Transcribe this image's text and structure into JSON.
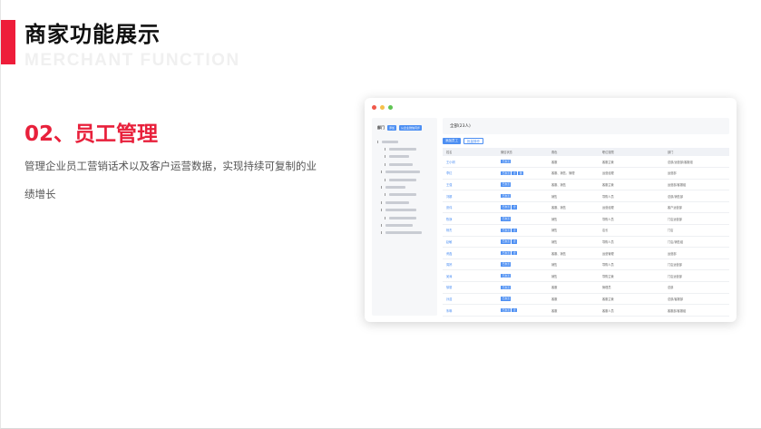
{
  "header": {
    "title": "商家功能展示",
    "subtitle": "MERCHANT FUNCTION",
    "accent_color": "#ee1d3a"
  },
  "section": {
    "title": "02、员工管理",
    "description": "管理企业员工营销话术以及客户运营数据，实现持续可复制的业绩增长"
  },
  "mockup": {
    "sidebar": {
      "label": "部门",
      "btn_add": "添加",
      "btn_sync": "从企业微信同步",
      "tree_rows": 13
    },
    "main": {
      "count_label": "全部(23人)",
      "btn_add": "添加员工",
      "btn_manage": "批量操作",
      "columns": [
        "姓名",
        "微信状态",
        "角色",
        "职位权限",
        "部门"
      ],
      "rows": [
        {
          "name": "王小明",
          "tags": [
            "已激活"
          ],
          "role": "客服",
          "position": "客服主管",
          "dept": "总部/运营部/客服组"
        },
        {
          "name": "李红",
          "tags": [
            "已激活",
            "企",
            "微"
          ],
          "role": "客服、销售、管理",
          "position": "运营经理",
          "dept": "运营部"
        },
        {
          "name": "王强",
          "tags": [
            "已激活"
          ],
          "role": "客服、销售",
          "position": "客服主管",
          "dept": "运营部/客服组"
        },
        {
          "name": "刘娜",
          "tags": [
            "已激活"
          ],
          "role": "销售",
          "position": "导购人员",
          "dept": "总部/销售部"
        },
        {
          "name": "张伟",
          "tags": [
            "已激活",
            "企"
          ],
          "role": "客服、销售",
          "position": "运营经理",
          "dept": "客户运营部"
        },
        {
          "name": "陈静",
          "tags": [
            "已激活"
          ],
          "role": "销售",
          "position": "导购人员",
          "dept": "门店运营部"
        },
        {
          "name": "杨杰",
          "tags": [
            "已激活",
            "企"
          ],
          "role": "销售",
          "position": "店长",
          "dept": "门店"
        },
        {
          "name": "赵敏",
          "tags": [
            "已激活",
            "企"
          ],
          "role": "销售",
          "position": "导购人员",
          "dept": "门店/销售组"
        },
        {
          "name": "黄磊",
          "tags": [
            "已激活",
            "企"
          ],
          "role": "客服、销售",
          "position": "运营管理",
          "dept": "运营部"
        },
        {
          "name": "周婷",
          "tags": [
            "已激活"
          ],
          "role": "销售",
          "position": "导购人员",
          "dept": "门店运营部"
        },
        {
          "name": "吴涛",
          "tags": [
            "已激活"
          ],
          "role": "销售",
          "position": "导购主管",
          "dept": "门店运营部"
        },
        {
          "name": "徐丽",
          "tags": [
            "已激活"
          ],
          "role": "客服",
          "position": "管理员",
          "dept": "总部"
        },
        {
          "name": "孙浩",
          "tags": [
            "已激活"
          ],
          "role": "客服",
          "position": "客服主管",
          "dept": "总部/客服部"
        },
        {
          "name": "朱琳",
          "tags": [
            "已激活",
            "企"
          ],
          "role": "客服",
          "position": "客服人员",
          "dept": "客服部/客服组"
        }
      ]
    }
  }
}
